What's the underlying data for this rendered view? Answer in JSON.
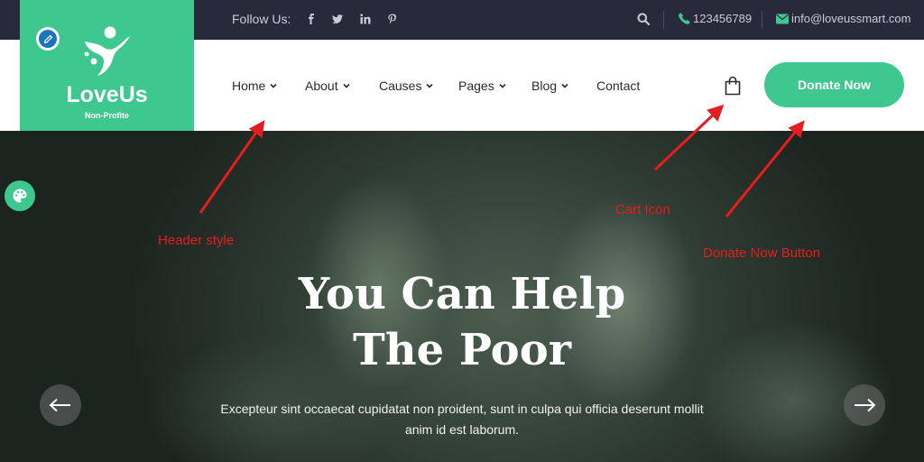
{
  "topbar": {
    "follow_label": "Follow Us:",
    "social_icons": [
      "facebook-icon",
      "twitter-icon",
      "linkedin-icon",
      "pinterest-icon"
    ],
    "phone": "123456789",
    "email": "info@loveussmart.com"
  },
  "logo": {
    "title": "LoveUs",
    "subtitle": "Non-Profite"
  },
  "nav": {
    "items": [
      {
        "label": "Home"
      },
      {
        "label": "About"
      },
      {
        "label": "Causes"
      },
      {
        "label": "Pages"
      },
      {
        "label": "Blog"
      },
      {
        "label": "Contact"
      }
    ]
  },
  "header": {
    "donate_label": "Donate Now"
  },
  "hero": {
    "title_line1": "You Can Help",
    "title_line2": "The Poor",
    "text_line1": "Excepteur sint occaecat cupidatat non proident, sunt in culpa qui officia deserunt mollit",
    "text_line2": "anim id est laborum."
  },
  "annotations": {
    "header_style": "Header style",
    "cart_icon": "Cart Icon",
    "donate_button": "Donate Now Button"
  },
  "colors": {
    "accent": "#3ec78e",
    "topbar": "#282a3c",
    "annotation": "#e21e1e"
  }
}
